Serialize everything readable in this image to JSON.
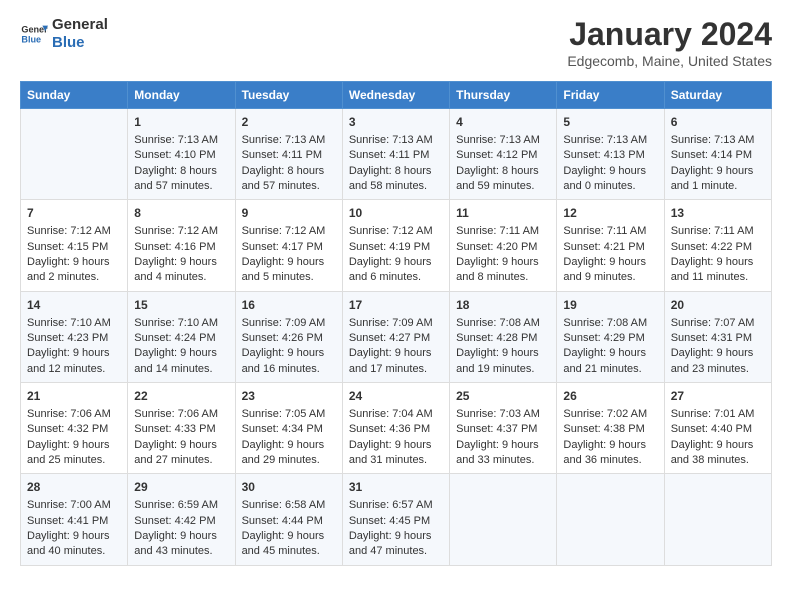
{
  "header": {
    "logo_line1": "General",
    "logo_line2": "Blue",
    "month": "January 2024",
    "location": "Edgecomb, Maine, United States"
  },
  "weekdays": [
    "Sunday",
    "Monday",
    "Tuesday",
    "Wednesday",
    "Thursday",
    "Friday",
    "Saturday"
  ],
  "weeks": [
    [
      {
        "day": "",
        "content": ""
      },
      {
        "day": "1",
        "content": "Sunrise: 7:13 AM\nSunset: 4:10 PM\nDaylight: 8 hours\nand 57 minutes."
      },
      {
        "day": "2",
        "content": "Sunrise: 7:13 AM\nSunset: 4:11 PM\nDaylight: 8 hours\nand 57 minutes."
      },
      {
        "day": "3",
        "content": "Sunrise: 7:13 AM\nSunset: 4:11 PM\nDaylight: 8 hours\nand 58 minutes."
      },
      {
        "day": "4",
        "content": "Sunrise: 7:13 AM\nSunset: 4:12 PM\nDaylight: 8 hours\nand 59 minutes."
      },
      {
        "day": "5",
        "content": "Sunrise: 7:13 AM\nSunset: 4:13 PM\nDaylight: 9 hours\nand 0 minutes."
      },
      {
        "day": "6",
        "content": "Sunrise: 7:13 AM\nSunset: 4:14 PM\nDaylight: 9 hours\nand 1 minute."
      }
    ],
    [
      {
        "day": "7",
        "content": "Sunrise: 7:12 AM\nSunset: 4:15 PM\nDaylight: 9 hours\nand 2 minutes."
      },
      {
        "day": "8",
        "content": "Sunrise: 7:12 AM\nSunset: 4:16 PM\nDaylight: 9 hours\nand 4 minutes."
      },
      {
        "day": "9",
        "content": "Sunrise: 7:12 AM\nSunset: 4:17 PM\nDaylight: 9 hours\nand 5 minutes."
      },
      {
        "day": "10",
        "content": "Sunrise: 7:12 AM\nSunset: 4:19 PM\nDaylight: 9 hours\nand 6 minutes."
      },
      {
        "day": "11",
        "content": "Sunrise: 7:11 AM\nSunset: 4:20 PM\nDaylight: 9 hours\nand 8 minutes."
      },
      {
        "day": "12",
        "content": "Sunrise: 7:11 AM\nSunset: 4:21 PM\nDaylight: 9 hours\nand 9 minutes."
      },
      {
        "day": "13",
        "content": "Sunrise: 7:11 AM\nSunset: 4:22 PM\nDaylight: 9 hours\nand 11 minutes."
      }
    ],
    [
      {
        "day": "14",
        "content": "Sunrise: 7:10 AM\nSunset: 4:23 PM\nDaylight: 9 hours\nand 12 minutes."
      },
      {
        "day": "15",
        "content": "Sunrise: 7:10 AM\nSunset: 4:24 PM\nDaylight: 9 hours\nand 14 minutes."
      },
      {
        "day": "16",
        "content": "Sunrise: 7:09 AM\nSunset: 4:26 PM\nDaylight: 9 hours\nand 16 minutes."
      },
      {
        "day": "17",
        "content": "Sunrise: 7:09 AM\nSunset: 4:27 PM\nDaylight: 9 hours\nand 17 minutes."
      },
      {
        "day": "18",
        "content": "Sunrise: 7:08 AM\nSunset: 4:28 PM\nDaylight: 9 hours\nand 19 minutes."
      },
      {
        "day": "19",
        "content": "Sunrise: 7:08 AM\nSunset: 4:29 PM\nDaylight: 9 hours\nand 21 minutes."
      },
      {
        "day": "20",
        "content": "Sunrise: 7:07 AM\nSunset: 4:31 PM\nDaylight: 9 hours\nand 23 minutes."
      }
    ],
    [
      {
        "day": "21",
        "content": "Sunrise: 7:06 AM\nSunset: 4:32 PM\nDaylight: 9 hours\nand 25 minutes."
      },
      {
        "day": "22",
        "content": "Sunrise: 7:06 AM\nSunset: 4:33 PM\nDaylight: 9 hours\nand 27 minutes."
      },
      {
        "day": "23",
        "content": "Sunrise: 7:05 AM\nSunset: 4:34 PM\nDaylight: 9 hours\nand 29 minutes."
      },
      {
        "day": "24",
        "content": "Sunrise: 7:04 AM\nSunset: 4:36 PM\nDaylight: 9 hours\nand 31 minutes."
      },
      {
        "day": "25",
        "content": "Sunrise: 7:03 AM\nSunset: 4:37 PM\nDaylight: 9 hours\nand 33 minutes."
      },
      {
        "day": "26",
        "content": "Sunrise: 7:02 AM\nSunset: 4:38 PM\nDaylight: 9 hours\nand 36 minutes."
      },
      {
        "day": "27",
        "content": "Sunrise: 7:01 AM\nSunset: 4:40 PM\nDaylight: 9 hours\nand 38 minutes."
      }
    ],
    [
      {
        "day": "28",
        "content": "Sunrise: 7:00 AM\nSunset: 4:41 PM\nDaylight: 9 hours\nand 40 minutes."
      },
      {
        "day": "29",
        "content": "Sunrise: 6:59 AM\nSunset: 4:42 PM\nDaylight: 9 hours\nand 43 minutes."
      },
      {
        "day": "30",
        "content": "Sunrise: 6:58 AM\nSunset: 4:44 PM\nDaylight: 9 hours\nand 45 minutes."
      },
      {
        "day": "31",
        "content": "Sunrise: 6:57 AM\nSunset: 4:45 PM\nDaylight: 9 hours\nand 47 minutes."
      },
      {
        "day": "",
        "content": ""
      },
      {
        "day": "",
        "content": ""
      },
      {
        "day": "",
        "content": ""
      }
    ]
  ]
}
